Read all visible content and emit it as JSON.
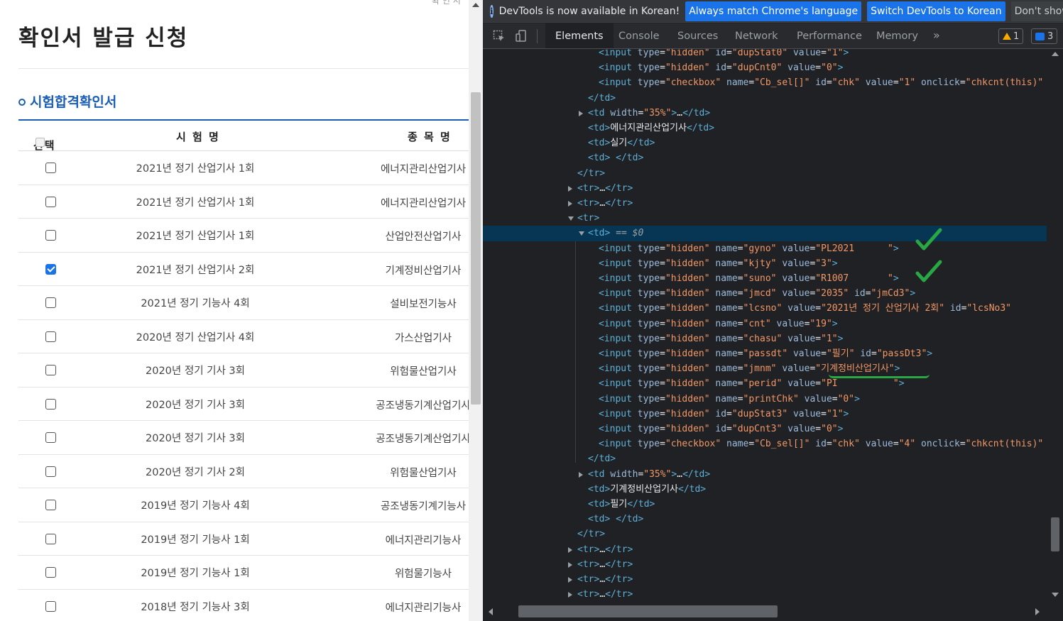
{
  "page": {
    "title": "확인서 발급 신청",
    "corner_text": "확 인 서",
    "section_title": "시험합격확인서",
    "headers": {
      "select": "선택",
      "exam": "시 험 명",
      "subject": "종 목 명"
    },
    "rows": [
      {
        "exam": "2021년 정기 산업기사 1회",
        "subject": "에너지관리산업기사",
        "checked": false
      },
      {
        "exam": "2021년 정기 산업기사 1회",
        "subject": "에너지관리산업기사",
        "checked": false
      },
      {
        "exam": "2021년 정기 산업기사 1회",
        "subject": "산업안전산업기사",
        "checked": false
      },
      {
        "exam": "2021년 정기 산업기사 2회",
        "subject": "기계정비산업기사",
        "checked": true
      },
      {
        "exam": "2021년 정기 기능사 4회",
        "subject": "설비보전기능사",
        "checked": false
      },
      {
        "exam": "2020년 정기 산업기사 4회",
        "subject": "가스산업기사",
        "checked": false
      },
      {
        "exam": "2020년 정기 기사 3회",
        "subject": "위험물산업기사",
        "checked": false
      },
      {
        "exam": "2020년 정기 기사 3회",
        "subject": "공조냉동기계산업기사",
        "checked": false
      },
      {
        "exam": "2020년 정기 기사 3회",
        "subject": "공조냉동기계산업기사",
        "checked": false
      },
      {
        "exam": "2020년 정기 기사 2회",
        "subject": "위험물산업기사",
        "checked": false
      },
      {
        "exam": "2019년 정기 기능사 4회",
        "subject": "공조냉동기계기능사",
        "checked": false
      },
      {
        "exam": "2019년 정기 기능사 1회",
        "subject": "에너지관리기능사",
        "checked": false
      },
      {
        "exam": "2019년 정기 기능사 1회",
        "subject": "위험물기능사",
        "checked": false
      },
      {
        "exam": "2018년 정기 기능사 3회",
        "subject": "에너지관리기능사",
        "checked": false
      }
    ]
  },
  "devtools": {
    "infobar": {
      "message": "DevTools is now available in Korean!",
      "btn_match": "Always match Chrome's language",
      "btn_switch": "Switch DevTools to Korean",
      "btn_dont": "Don't show again"
    },
    "tabs": [
      "Elements",
      "Console",
      "Sources",
      "Network",
      "Performance",
      "Memory"
    ],
    "more_tabs": "»",
    "warnings_count": "1",
    "messages_count": "3",
    "colors": {
      "accent": "#1a73e8",
      "tag": "#5db0d7",
      "attr": "#9bbbdc",
      "value": "#f29766",
      "selected_row": "#073655",
      "annotation": "#27a844"
    },
    "code_lines": [
      [
        {
          "c": "t",
          "s": "<input "
        },
        {
          "c": "a",
          "s": "type"
        },
        {
          "c": "x",
          "s": "="
        },
        {
          "c": "v",
          "s": "\"hidden\""
        },
        {
          "c": "a",
          "s": " id"
        },
        {
          "c": "x",
          "s": "="
        },
        {
          "c": "v",
          "s": "\"dupStat0\""
        },
        {
          "c": "a",
          "s": " value"
        },
        {
          "c": "x",
          "s": "="
        },
        {
          "c": "v",
          "s": "\"1\""
        },
        {
          "c": "t",
          "s": ">"
        }
      ],
      [
        {
          "c": "t",
          "s": "<input "
        },
        {
          "c": "a",
          "s": "type"
        },
        {
          "c": "x",
          "s": "="
        },
        {
          "c": "v",
          "s": "\"hidden\""
        },
        {
          "c": "a",
          "s": " id"
        },
        {
          "c": "x",
          "s": "="
        },
        {
          "c": "v",
          "s": "\"dupCnt0\""
        },
        {
          "c": "a",
          "s": " value"
        },
        {
          "c": "x",
          "s": "="
        },
        {
          "c": "v",
          "s": "\"0\""
        },
        {
          "c": "t",
          "s": ">"
        }
      ],
      [
        {
          "c": "t",
          "s": "<input "
        },
        {
          "c": "a",
          "s": "type"
        },
        {
          "c": "x",
          "s": "="
        },
        {
          "c": "v",
          "s": "\"checkbox\""
        },
        {
          "c": "a",
          "s": " name"
        },
        {
          "c": "x",
          "s": "="
        },
        {
          "c": "v",
          "s": "\"Cb_sel[]\""
        },
        {
          "c": "a",
          "s": " id"
        },
        {
          "c": "x",
          "s": "="
        },
        {
          "c": "v",
          "s": "\"chk\""
        },
        {
          "c": "a",
          "s": " value"
        },
        {
          "c": "x",
          "s": "="
        },
        {
          "c": "v",
          "s": "\"1\""
        },
        {
          "c": "a",
          "s": " onclick"
        },
        {
          "c": "x",
          "s": "="
        },
        {
          "c": "v",
          "s": "\"chkcnt(this)\""
        }
      ],
      [
        {
          "c": "t",
          "s": "</td>"
        }
      ],
      [
        {
          "c": "t",
          "s": "<td "
        },
        {
          "c": "a",
          "s": "width"
        },
        {
          "c": "x",
          "s": "="
        },
        {
          "c": "v",
          "s": "\"35%\""
        },
        {
          "c": "t",
          "s": ">"
        },
        {
          "c": "x",
          "s": "…"
        },
        {
          "c": "t",
          "s": "</td>"
        }
      ],
      [
        {
          "c": "t",
          "s": "<td>"
        },
        {
          "c": "x",
          "s": "에너지관리산업기사"
        },
        {
          "c": "t",
          "s": "</td>"
        }
      ],
      [
        {
          "c": "t",
          "s": "<td>"
        },
        {
          "c": "x",
          "s": "실기"
        },
        {
          "c": "t",
          "s": "</td>"
        }
      ],
      [
        {
          "c": "t",
          "s": "<td>"
        },
        {
          "c": "x",
          "s": " "
        },
        {
          "c": "t",
          "s": "</td>"
        }
      ],
      [
        {
          "c": "t",
          "s": "</tr>"
        }
      ],
      [
        {
          "c": "t",
          "s": "<tr>"
        },
        {
          "c": "x",
          "s": "…"
        },
        {
          "c": "t",
          "s": "</tr>"
        }
      ],
      [
        {
          "c": "t",
          "s": "<tr>"
        },
        {
          "c": "x",
          "s": "…"
        },
        {
          "c": "t",
          "s": "</tr>"
        }
      ],
      [
        {
          "c": "t",
          "s": "<tr>"
        }
      ],
      [
        {
          "c": "t",
          "s": "<td>"
        },
        {
          "c": "s0",
          "s": " == $0"
        }
      ],
      [
        {
          "c": "t",
          "s": "<input "
        },
        {
          "c": "a",
          "s": "type"
        },
        {
          "c": "x",
          "s": "="
        },
        {
          "c": "v",
          "s": "\"hidden\""
        },
        {
          "c": "a",
          "s": " name"
        },
        {
          "c": "x",
          "s": "="
        },
        {
          "c": "v",
          "s": "\"gyno\""
        },
        {
          "c": "a",
          "s": " value"
        },
        {
          "c": "x",
          "s": "="
        },
        {
          "c": "v",
          "s": "\"PL2021      \""
        },
        {
          "c": "t",
          "s": ">"
        }
      ],
      [
        {
          "c": "t",
          "s": "<input "
        },
        {
          "c": "a",
          "s": "type"
        },
        {
          "c": "x",
          "s": "="
        },
        {
          "c": "v",
          "s": "\"hidden\""
        },
        {
          "c": "a",
          "s": " name"
        },
        {
          "c": "x",
          "s": "="
        },
        {
          "c": "v",
          "s": "\"kjty\""
        },
        {
          "c": "a",
          "s": " value"
        },
        {
          "c": "x",
          "s": "="
        },
        {
          "c": "v",
          "s": "\"3\""
        },
        {
          "c": "t",
          "s": ">"
        }
      ],
      [
        {
          "c": "t",
          "s": "<input "
        },
        {
          "c": "a",
          "s": "type"
        },
        {
          "c": "x",
          "s": "="
        },
        {
          "c": "v",
          "s": "\"hidden\""
        },
        {
          "c": "a",
          "s": " name"
        },
        {
          "c": "x",
          "s": "="
        },
        {
          "c": "v",
          "s": "\"suno\""
        },
        {
          "c": "a",
          "s": " value"
        },
        {
          "c": "x",
          "s": "="
        },
        {
          "c": "v",
          "s": "\"R1007       \""
        },
        {
          "c": "t",
          "s": ">"
        }
      ],
      [
        {
          "c": "t",
          "s": "<input "
        },
        {
          "c": "a",
          "s": "type"
        },
        {
          "c": "x",
          "s": "="
        },
        {
          "c": "v",
          "s": "\"hidden\""
        },
        {
          "c": "a",
          "s": " name"
        },
        {
          "c": "x",
          "s": "="
        },
        {
          "c": "v",
          "s": "\"jmcd\""
        },
        {
          "c": "a",
          "s": " value"
        },
        {
          "c": "x",
          "s": "="
        },
        {
          "c": "v",
          "s": "\"2035\""
        },
        {
          "c": "a",
          "s": " id"
        },
        {
          "c": "x",
          "s": "="
        },
        {
          "c": "v",
          "s": "\"jmCd3\""
        },
        {
          "c": "t",
          "s": ">"
        }
      ],
      [
        {
          "c": "t",
          "s": "<input "
        },
        {
          "c": "a",
          "s": "type"
        },
        {
          "c": "x",
          "s": "="
        },
        {
          "c": "v",
          "s": "\"hidden\""
        },
        {
          "c": "a",
          "s": " name"
        },
        {
          "c": "x",
          "s": "="
        },
        {
          "c": "v",
          "s": "\"lcsno\""
        },
        {
          "c": "a",
          "s": " value"
        },
        {
          "c": "x",
          "s": "="
        },
        {
          "c": "v",
          "s": "\"2021년 정기 산업기사 2회\""
        },
        {
          "c": "a",
          "s": " id"
        },
        {
          "c": "x",
          "s": "="
        },
        {
          "c": "v",
          "s": "\"lcsNo3\""
        }
      ],
      [
        {
          "c": "t",
          "s": "<input "
        },
        {
          "c": "a",
          "s": "type"
        },
        {
          "c": "x",
          "s": "="
        },
        {
          "c": "v",
          "s": "\"hidden\""
        },
        {
          "c": "a",
          "s": " name"
        },
        {
          "c": "x",
          "s": "="
        },
        {
          "c": "v",
          "s": "\"cnt\""
        },
        {
          "c": "a",
          "s": " value"
        },
        {
          "c": "x",
          "s": "="
        },
        {
          "c": "v",
          "s": "\"19\""
        },
        {
          "c": "t",
          "s": ">"
        }
      ],
      [
        {
          "c": "t",
          "s": "<input "
        },
        {
          "c": "a",
          "s": "type"
        },
        {
          "c": "x",
          "s": "="
        },
        {
          "c": "v",
          "s": "\"hidden\""
        },
        {
          "c": "a",
          "s": " name"
        },
        {
          "c": "x",
          "s": "="
        },
        {
          "c": "v",
          "s": "\"chasu\""
        },
        {
          "c": "a",
          "s": " value"
        },
        {
          "c": "x",
          "s": "="
        },
        {
          "c": "v",
          "s": "\"1\""
        },
        {
          "c": "t",
          "s": ">"
        }
      ],
      [
        {
          "c": "t",
          "s": "<input "
        },
        {
          "c": "a",
          "s": "type"
        },
        {
          "c": "x",
          "s": "="
        },
        {
          "c": "v",
          "s": "\"hidden\""
        },
        {
          "c": "a",
          "s": " name"
        },
        {
          "c": "x",
          "s": "="
        },
        {
          "c": "v",
          "s": "\"passdt\""
        },
        {
          "c": "a",
          "s": " value"
        },
        {
          "c": "x",
          "s": "="
        },
        {
          "c": "v",
          "s": "\"필기\""
        },
        {
          "c": "a",
          "s": " id"
        },
        {
          "c": "x",
          "s": "="
        },
        {
          "c": "v",
          "s": "\"passDt3\""
        },
        {
          "c": "t",
          "s": ">"
        }
      ],
      [
        {
          "c": "t",
          "s": "<input "
        },
        {
          "c": "a",
          "s": "type"
        },
        {
          "c": "x",
          "s": "="
        },
        {
          "c": "v",
          "s": "\"hidden\""
        },
        {
          "c": "a",
          "s": " name"
        },
        {
          "c": "x",
          "s": "="
        },
        {
          "c": "v",
          "s": "\"jmnm\""
        },
        {
          "c": "a",
          "s": " value"
        },
        {
          "c": "x",
          "s": "="
        },
        {
          "c": "v",
          "s": "\"기계정비산업기사\""
        },
        {
          "c": "t",
          "s": ">"
        }
      ],
      [
        {
          "c": "t",
          "s": "<input "
        },
        {
          "c": "a",
          "s": "type"
        },
        {
          "c": "x",
          "s": "="
        },
        {
          "c": "v",
          "s": "\"hidden\""
        },
        {
          "c": "a",
          "s": " name"
        },
        {
          "c": "x",
          "s": "="
        },
        {
          "c": "v",
          "s": "\"perid\""
        },
        {
          "c": "a",
          "s": " value"
        },
        {
          "c": "x",
          "s": "="
        },
        {
          "c": "v",
          "s": "\"PI          \""
        },
        {
          "c": "t",
          "s": ">"
        }
      ],
      [
        {
          "c": "t",
          "s": "<input "
        },
        {
          "c": "a",
          "s": "type"
        },
        {
          "c": "x",
          "s": "="
        },
        {
          "c": "v",
          "s": "\"hidden\""
        },
        {
          "c": "a",
          "s": " name"
        },
        {
          "c": "x",
          "s": "="
        },
        {
          "c": "v",
          "s": "\"printChk\""
        },
        {
          "c": "a",
          "s": " value"
        },
        {
          "c": "x",
          "s": "="
        },
        {
          "c": "v",
          "s": "\"0\""
        },
        {
          "c": "t",
          "s": ">"
        }
      ],
      [
        {
          "c": "t",
          "s": "<input "
        },
        {
          "c": "a",
          "s": "type"
        },
        {
          "c": "x",
          "s": "="
        },
        {
          "c": "v",
          "s": "\"hidden\""
        },
        {
          "c": "a",
          "s": " id"
        },
        {
          "c": "x",
          "s": "="
        },
        {
          "c": "v",
          "s": "\"dupStat3\""
        },
        {
          "c": "a",
          "s": " value"
        },
        {
          "c": "x",
          "s": "="
        },
        {
          "c": "v",
          "s": "\"1\""
        },
        {
          "c": "t",
          "s": ">"
        }
      ],
      [
        {
          "c": "t",
          "s": "<input "
        },
        {
          "c": "a",
          "s": "type"
        },
        {
          "c": "x",
          "s": "="
        },
        {
          "c": "v",
          "s": "\"hidden\""
        },
        {
          "c": "a",
          "s": " id"
        },
        {
          "c": "x",
          "s": "="
        },
        {
          "c": "v",
          "s": "\"dupCnt3\""
        },
        {
          "c": "a",
          "s": " value"
        },
        {
          "c": "x",
          "s": "="
        },
        {
          "c": "v",
          "s": "\"0\""
        },
        {
          "c": "t",
          "s": ">"
        }
      ],
      [
        {
          "c": "t",
          "s": "<input "
        },
        {
          "c": "a",
          "s": "type"
        },
        {
          "c": "x",
          "s": "="
        },
        {
          "c": "v",
          "s": "\"checkbox\""
        },
        {
          "c": "a",
          "s": " name"
        },
        {
          "c": "x",
          "s": "="
        },
        {
          "c": "v",
          "s": "\"Cb_sel[]\""
        },
        {
          "c": "a",
          "s": " id"
        },
        {
          "c": "x",
          "s": "="
        },
        {
          "c": "v",
          "s": "\"chk\""
        },
        {
          "c": "a",
          "s": " value"
        },
        {
          "c": "x",
          "s": "="
        },
        {
          "c": "v",
          "s": "\"4\""
        },
        {
          "c": "a",
          "s": " onclick"
        },
        {
          "c": "x",
          "s": "="
        },
        {
          "c": "v",
          "s": "\"chkcnt(this)\""
        }
      ],
      [
        {
          "c": "t",
          "s": "</td>"
        }
      ],
      [
        {
          "c": "t",
          "s": "<td "
        },
        {
          "c": "a",
          "s": "width"
        },
        {
          "c": "x",
          "s": "="
        },
        {
          "c": "v",
          "s": "\"35%\""
        },
        {
          "c": "t",
          "s": ">"
        },
        {
          "c": "x",
          "s": "…"
        },
        {
          "c": "t",
          "s": "</td>"
        }
      ],
      [
        {
          "c": "t",
          "s": "<td>"
        },
        {
          "c": "x",
          "s": "기계정비산업기사"
        },
        {
          "c": "t",
          "s": "</td>"
        }
      ],
      [
        {
          "c": "t",
          "s": "<td>"
        },
        {
          "c": "x",
          "s": "필기"
        },
        {
          "c": "t",
          "s": "</td>"
        }
      ],
      [
        {
          "c": "t",
          "s": "<td>"
        },
        {
          "c": "x",
          "s": " "
        },
        {
          "c": "t",
          "s": "</td>"
        }
      ],
      [
        {
          "c": "t",
          "s": "</tr>"
        }
      ],
      [
        {
          "c": "t",
          "s": "<tr>"
        },
        {
          "c": "x",
          "s": "…"
        },
        {
          "c": "t",
          "s": "</tr>"
        }
      ],
      [
        {
          "c": "t",
          "s": "<tr>"
        },
        {
          "c": "x",
          "s": "…"
        },
        {
          "c": "t",
          "s": "</tr>"
        }
      ],
      [
        {
          "c": "t",
          "s": "<tr>"
        },
        {
          "c": "x",
          "s": "…"
        },
        {
          "c": "t",
          "s": "</tr>"
        }
      ],
      [
        {
          "c": "t",
          "s": "<tr>"
        },
        {
          "c": "x",
          "s": "…"
        },
        {
          "c": "t",
          "s": "</tr>"
        }
      ]
    ]
  }
}
